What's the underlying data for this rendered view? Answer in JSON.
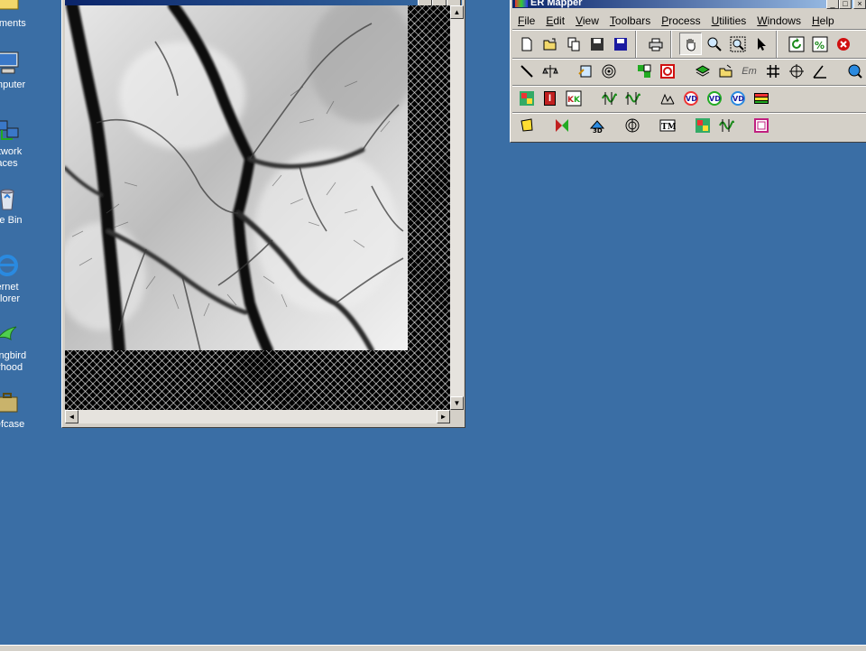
{
  "desktop": {
    "icons": [
      {
        "label": "cuments"
      },
      {
        "label": "omputer"
      },
      {
        "label": "etwork",
        "label2": "aces"
      },
      {
        "label": "cle Bin"
      },
      {
        "label": "ernet",
        "label2": "plorer"
      },
      {
        "label": "mingbird",
        "label2": "orhood"
      },
      {
        "label": "riefcase"
      }
    ]
  },
  "image_window": {
    "scroll_up": "▲",
    "scroll_down": "▼",
    "scroll_left": "◄",
    "scroll_right": "►"
  },
  "er_mapper": {
    "title": "ER Mapper",
    "window_buttons": {
      "minimize": "_",
      "maximize": "□",
      "close": "×"
    },
    "menu": [
      {
        "label": "File",
        "u": "F",
        "rest": "ile"
      },
      {
        "label": "Edit",
        "u": "E",
        "rest": "dit"
      },
      {
        "label": "View",
        "u": "V",
        "rest": "iew"
      },
      {
        "label": "Toolbars",
        "u": "T",
        "rest": "oolbars"
      },
      {
        "label": "Process",
        "u": "P",
        "rest": "rocess"
      },
      {
        "label": "Utilities",
        "u": "U",
        "rest": "tilities"
      },
      {
        "label": "Windows",
        "u": "W",
        "rest": "indows"
      },
      {
        "label": "Help",
        "u": "H",
        "rest": "elp"
      }
    ],
    "toolbar_text": {
      "edit_label": "I",
      "three_d": "3D",
      "tm": "TM",
      "vd": "VD",
      "em": "Em"
    }
  },
  "colors": {
    "desktop": "#3a6ea5",
    "window_face": "#d4d0c8",
    "title_active": "#0a246a"
  }
}
